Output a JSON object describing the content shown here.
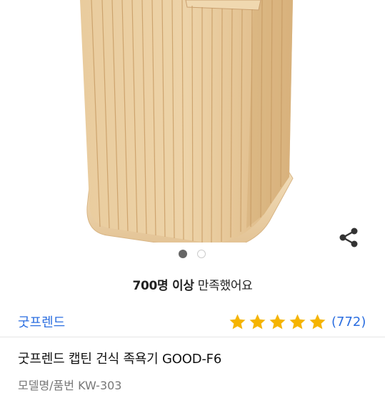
{
  "gallery": {
    "image_alt": "Wooden foot bath box (product photo)",
    "total_images": 2,
    "active_index": 1
  },
  "share": {
    "icon": "share-icon"
  },
  "satisfaction": {
    "count_text": "700명 이상",
    "suffix_text": " 만족했어요"
  },
  "brand": {
    "name": "굿프렌드"
  },
  "rating": {
    "stars": 5,
    "star_color": "#f5b400",
    "review_count": "(772)"
  },
  "product": {
    "name": "굿프렌드 캡틴 건식 족욕기 GOOD-F6",
    "model_partial": "모델명/품번  KW-303"
  },
  "colors": {
    "link": "#2b6ee0",
    "wood": "#e8c9a0"
  }
}
